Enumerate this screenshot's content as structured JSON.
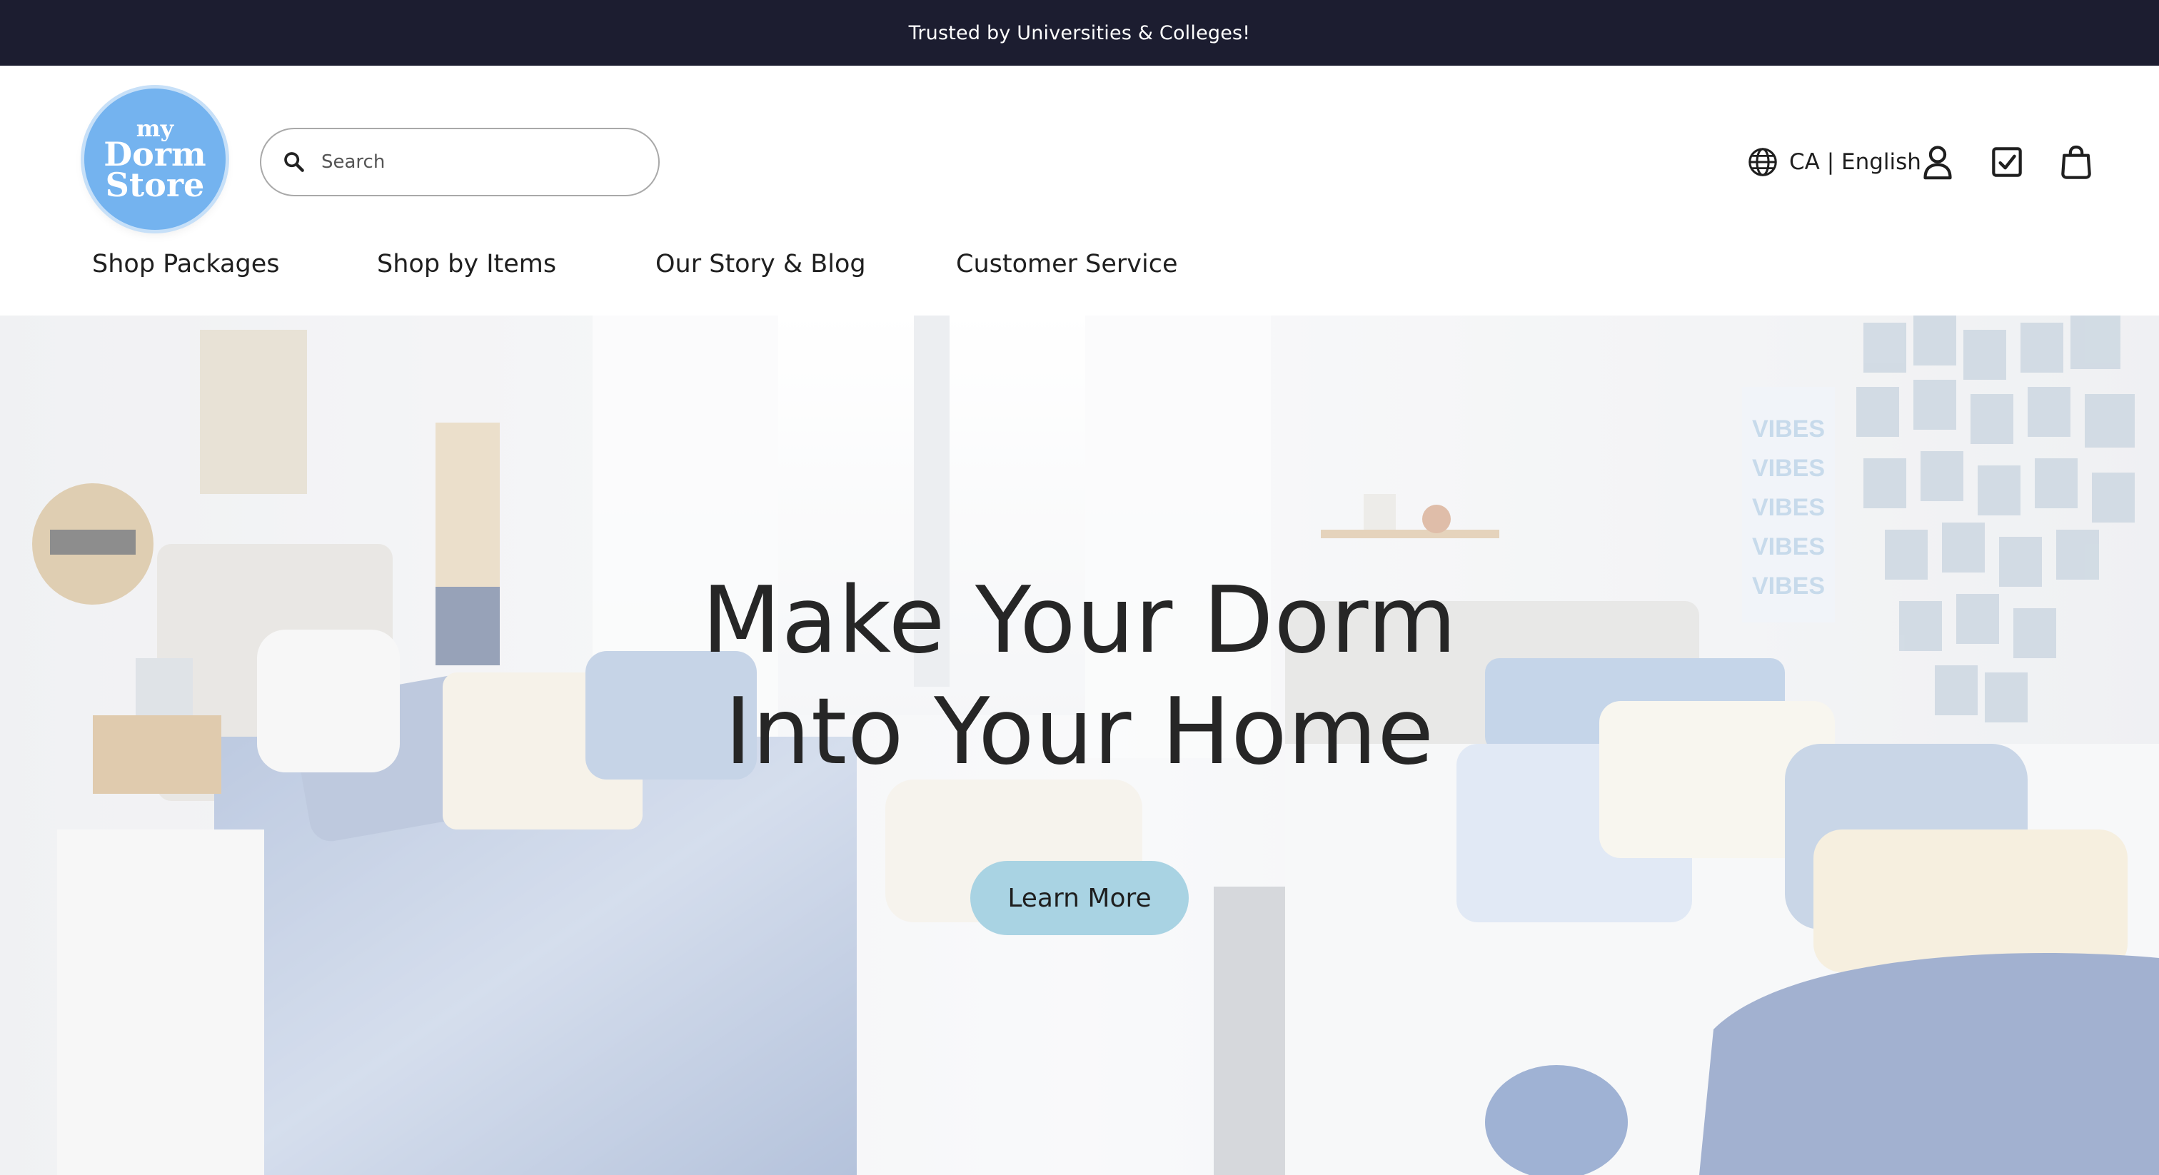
{
  "announcement": {
    "text": "Trusted by Universities & Colleges!"
  },
  "logo": {
    "line1": "my",
    "line2": "Dorm",
    "line3": "Store"
  },
  "search": {
    "placeholder": "Search",
    "value": ""
  },
  "locale": {
    "label": "CA | English"
  },
  "icons": {
    "search": "search-icon",
    "globe": "globe-icon",
    "account": "account-icon",
    "checklist": "checklist-icon",
    "bag": "shopping-bag-icon"
  },
  "nav": {
    "items": [
      {
        "label": "Shop Packages"
      },
      {
        "label": "Shop by Items"
      },
      {
        "label": "Our Story & Blog"
      },
      {
        "label": "Customer Service"
      }
    ]
  },
  "hero": {
    "headline_line1": "Make Your Dorm",
    "headline_line2": "Into Your Home",
    "cta_label": "Learn More",
    "poster_text": "VIBES"
  },
  "colors": {
    "topbar": "#1c1d30",
    "logo": "#74b3ef",
    "cta": "#a9d3e3",
    "text": "#1f1f1f"
  }
}
